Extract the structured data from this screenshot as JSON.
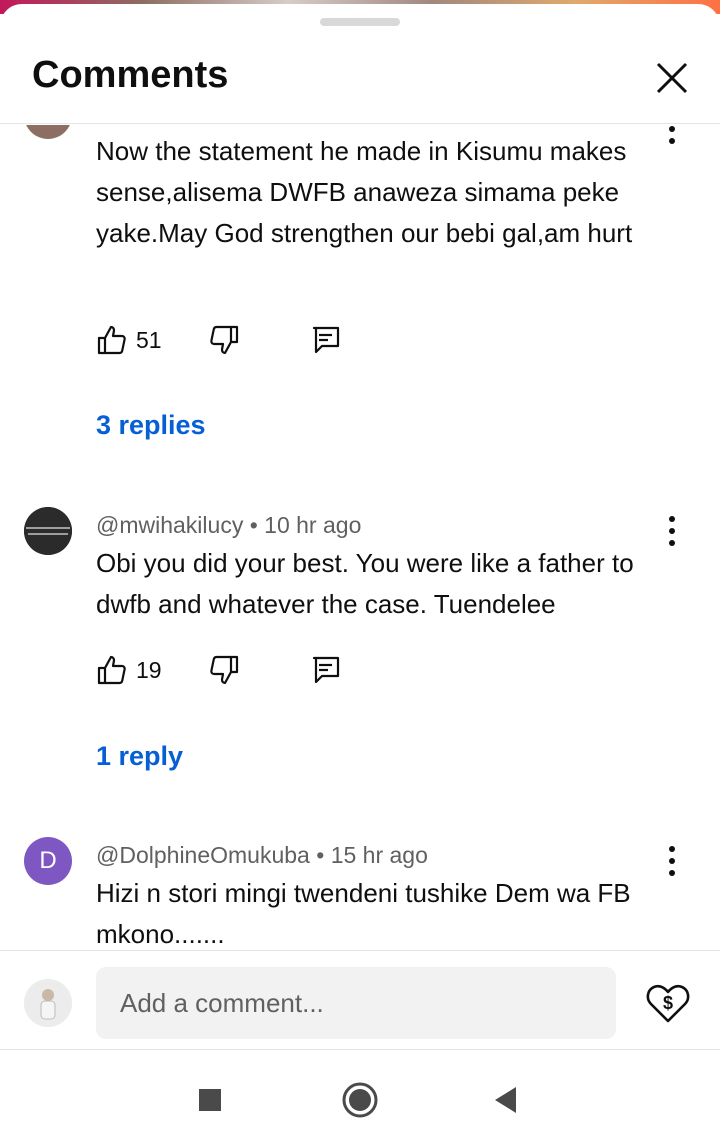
{
  "sheet": {
    "title": "Comments"
  },
  "comments": [
    {
      "author": "",
      "time": "",
      "text": "Now the statement he made in Kisumu makes sense,alisema DWFB anaweza simama peke yake.May God strengthen our bebi gal,am hurt",
      "likes": "51",
      "replies_label": "3 replies",
      "avatar_color": "#8d6e63"
    },
    {
      "author": "@mwihakilucy",
      "time": "10 hr ago",
      "text": "Obi you did your best. You were like a father to dwfb and whatever the case. Tuendelee",
      "likes": "19",
      "replies_label": "1 reply",
      "avatar_color": "#2b2b2b"
    },
    {
      "author": "@DolphineOmukuba",
      "time": "15 hr ago",
      "text": "Hizi n stori mingi twendeni tushike Dem wa FB mkono.......",
      "avatar_letter": "D",
      "avatar_color": "#7e57c2"
    }
  ],
  "separator": "•",
  "composer": {
    "placeholder": "Add a comment..."
  },
  "icons": {
    "like": "thumb-up-icon",
    "dislike": "thumb-down-icon",
    "reply": "reply-comment-icon",
    "more": "more-vertical-icon",
    "close": "close-icon",
    "thanks": "super-thanks-heart-dollar-icon",
    "nav": [
      "recents-square-icon",
      "home-circle-icon",
      "back-triangle-icon"
    ]
  },
  "colors": {
    "link": "#065fd4",
    "text": "#0f0f0f",
    "meta": "#606060"
  }
}
